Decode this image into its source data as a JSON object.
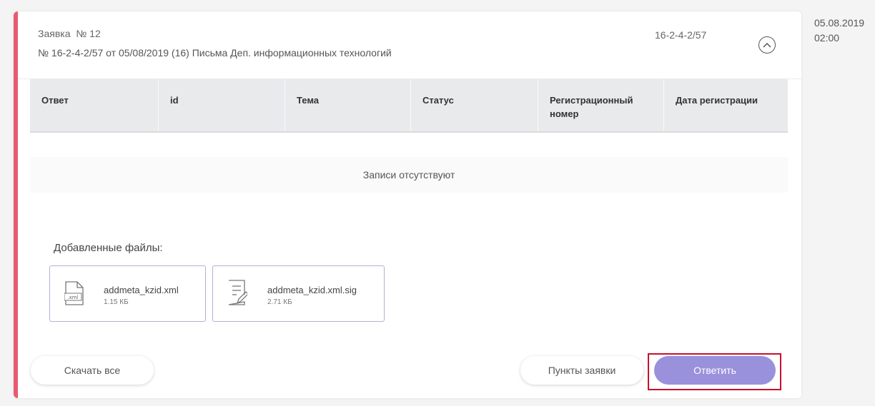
{
  "request": {
    "title": "Заявка  № 12",
    "subtitle": "№ 16-2-4-2/57 от 05/08/2019 (16) Письма Деп. информационных технологий",
    "number": "16-2-4-2/57",
    "accent_color": "#e85a70"
  },
  "table": {
    "columns": [
      "Ответ",
      "id",
      "Тема",
      "Статус",
      "Регистрационный номер",
      "Дата регистрации"
    ],
    "empty_text": "Записи отсутствуют"
  },
  "files": {
    "label": "Добавленные файлы:",
    "items": [
      {
        "name": "addmeta_kzid.xml",
        "size": "1.15 КБ",
        "icon": "xml-file-icon",
        "icon_text": ".xml"
      },
      {
        "name": "addmeta_kzid.xml.sig",
        "size": "2.71 КБ",
        "icon": "signed-document-icon"
      }
    ]
  },
  "buttons": {
    "download_all": "Скачать все",
    "request_items": "Пункты заявки",
    "reply": "Ответить",
    "reply_color": "#9a91dc"
  },
  "side": {
    "date": "05.08.2019",
    "time": "02:00"
  }
}
